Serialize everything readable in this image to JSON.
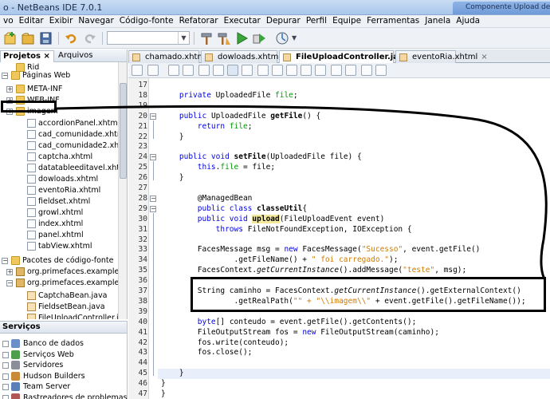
{
  "window": {
    "title": "o - NetBeans IDE 7.0.1",
    "background_tab": "Componente Upload de..."
  },
  "menu": [
    "vo",
    "Editar",
    "Exibir",
    "Navegar",
    "Código-fonte",
    "Refatorar",
    "Executar",
    "Depurar",
    "Perfil",
    "Equipe",
    "Ferramentas",
    "Janela",
    "Ajuda"
  ],
  "projects_panel": {
    "tabs": [
      "Projetos",
      "Arquivos"
    ],
    "tab_close": "×",
    "tree": [
      {
        "label": "Rid",
        "kind": "folder",
        "depth": 1
      },
      {
        "label": "Páginas Web",
        "kind": "folder",
        "depth": 0,
        "expander": "−"
      },
      {
        "label": "META-INF",
        "kind": "folder",
        "depth": 1,
        "expander": "+"
      },
      {
        "label": "WEB-INF",
        "kind": "folder",
        "depth": 1,
        "expander": "+"
      },
      {
        "label": "imagem",
        "kind": "folder",
        "depth": 1,
        "expander": "+"
      },
      {
        "label": "accordionPanel.xhtml",
        "kind": "file",
        "depth": 2
      },
      {
        "label": "cad_comunidade.xhtml",
        "kind": "file",
        "depth": 2
      },
      {
        "label": "cad_comunidade2.xhtml",
        "kind": "file",
        "depth": 2
      },
      {
        "label": "captcha.xhtml",
        "kind": "file",
        "depth": 2
      },
      {
        "label": "datatableeditavel.xhtml",
        "kind": "file",
        "depth": 2
      },
      {
        "label": "dowloads.xhtml",
        "kind": "file",
        "depth": 2
      },
      {
        "label": "eventoRia.xhtml",
        "kind": "file",
        "depth": 2
      },
      {
        "label": "fieldset.xhtml",
        "kind": "file",
        "depth": 2
      },
      {
        "label": "growl.xhtml",
        "kind": "file",
        "depth": 2
      },
      {
        "label": "index.xhtml",
        "kind": "file",
        "depth": 2
      },
      {
        "label": "panel.xhtml",
        "kind": "file",
        "depth": 2
      },
      {
        "label": "tabView.xhtml",
        "kind": "file",
        "depth": 2
      },
      {
        "label": "Pacotes de código-fonte",
        "kind": "folder",
        "depth": 0,
        "expander": "−"
      },
      {
        "label": "org.primefaces.examples.dom",
        "kind": "pkg",
        "depth": 1,
        "expander": "+"
      },
      {
        "label": "org.primefaces.examples.view",
        "kind": "pkg",
        "depth": 1,
        "expander": "−"
      },
      {
        "label": "CaptchaBean.java",
        "kind": "java",
        "depth": 2
      },
      {
        "label": "FieldsetBean.java",
        "kind": "java",
        "depth": 2
      },
      {
        "label": "FileUploadController.java",
        "kind": "java",
        "depth": 2
      }
    ]
  },
  "services_panel": {
    "title": "Serviços",
    "items": [
      {
        "label": "Banco de dados",
        "color": "#6b8fc7"
      },
      {
        "label": "Serviços Web",
        "color": "#4f9d4f"
      },
      {
        "label": "Servidores",
        "color": "#8a8f9a"
      },
      {
        "label": "Hudson Builders",
        "color": "#c98a3a"
      },
      {
        "label": "Team Server",
        "color": "#5a7fb8"
      },
      {
        "label": "Rastreadores de problemas",
        "color": "#b05656"
      }
    ]
  },
  "editor": {
    "tabs": [
      {
        "label": "chamado.xhtml",
        "active": false
      },
      {
        "label": "dowloads.xhtml",
        "active": false
      },
      {
        "label": "FileUploadController.java",
        "active": true
      },
      {
        "label": "eventoRia.xhtml",
        "active": false
      }
    ],
    "tab_close": "×",
    "lines": [
      {
        "n": "17",
        "code": ""
      },
      {
        "n": "18",
        "code": "    <span class=\"kw\">private</span> UploadedFile <span class=\"fld\">file</span>;"
      },
      {
        "n": "19",
        "code": ""
      },
      {
        "n": "20",
        "code": "    <span class=\"kw\">public</span> UploadedFile <span class=\"bold\">getFile</span>() {"
      },
      {
        "n": "21",
        "code": "        <span class=\"kw\">return</span> <span class=\"fld\">file</span>;"
      },
      {
        "n": "22",
        "code": "    }"
      },
      {
        "n": "23",
        "code": ""
      },
      {
        "n": "24",
        "code": "    <span class=\"kw\">public void</span> <span class=\"bold\">setFile</span>(UploadedFile file) {"
      },
      {
        "n": "25",
        "code": "        <span class=\"kw\">this</span>.<span class=\"fld\">file</span> = file;"
      },
      {
        "n": "26",
        "code": "    }"
      },
      {
        "n": "27",
        "code": ""
      },
      {
        "n": "28",
        "code": "        @ManagedBean"
      },
      {
        "n": "29",
        "code": "        <span class=\"kw\">public class</span> <span class=\"bold\">classeUtil</span>{"
      },
      {
        "n": "30",
        "code": "        <span class=\"kw\">public void</span> <span class=\"bold hl\">upload</span>(FileUploadEvent event)"
      },
      {
        "n": "31",
        "code": "            <span class=\"kw\">throws</span> FileNotFoundException, IOException {"
      },
      {
        "n": "32",
        "code": ""
      },
      {
        "n": "33",
        "code": "        FacesMessage msg = <span class=\"kw\">new</span> FacesMessage(<span class=\"str\">\"Sucesso\"</span>, event.getFile()"
      },
      {
        "n": "34",
        "code": "                .getFileName() + <span class=\"str\">\" foi carregado.\"</span>);"
      },
      {
        "n": "35",
        "code": "        FacesContext.<span class=\"it\">getCurrentInstance</span>().addMessage(<span class=\"str\">\"teste\"</span>, msg);"
      },
      {
        "n": "36",
        "code": ""
      },
      {
        "n": "37",
        "code": "        String caminho = FacesContext.<span class=\"it\">getCurrentInstance</span>().getExternalContext()"
      },
      {
        "n": "38",
        "code": "                .getRealPath(<span class=\"str\">\"\" + \"\\\\imagem\\\\\"</span> + event.getFile().getFileName());"
      },
      {
        "n": "39",
        "code": ""
      },
      {
        "n": "40",
        "code": "        <span class=\"kw\">byte</span>[] conteudo = event.getFile().getContents();"
      },
      {
        "n": "41",
        "code": "        FileOutputStream fos = <span class=\"kw\">new</span> FileOutputStream(caminho);"
      },
      {
        "n": "42",
        "code": "        fos.write(conteudo);"
      },
      {
        "n": "43",
        "code": "        fos.close();"
      },
      {
        "n": "44",
        "code": ""
      },
      {
        "n": "45",
        "code": "    }"
      },
      {
        "n": "46",
        "code": "}"
      },
      {
        "n": "47",
        "code": "}"
      }
    ]
  },
  "colors": {
    "keyword": "#0000e6",
    "field": "#009900",
    "string": "#ce7b00",
    "highlight": "#f4e99b"
  }
}
